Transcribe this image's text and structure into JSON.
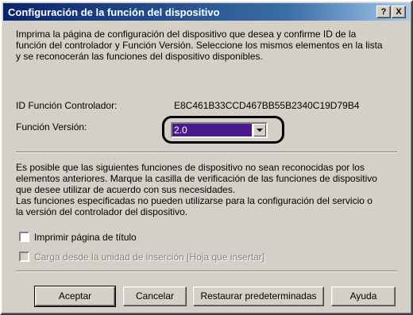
{
  "window": {
    "title": "Configuración de la función del dispositivo",
    "help_glyph": "?",
    "close_glyph": "X"
  },
  "intro": {
    "lines": [
      "Imprima la página de configuración del dispositivo que desea y confirme ID de la",
      "función del controlador y Función Versión. Seleccione los mismos elementos en la lista",
      "y se reconocerán las funciones del dispositivo disponibles."
    ]
  },
  "fields": {
    "id_label": "ID Función Controlador:",
    "id_value": "E8C461B33CCD467BB55B2340C19D79B4",
    "version_label": "Función Versión:",
    "version_selected": "2.0"
  },
  "description": {
    "lines": [
      "Es posible que las siguientes funciones de dispositivo no sean reconocidas por los",
      "elementos anteriores. Marque la casilla de verificación de las funciones de dispositivo",
      "que desee utilizar de acuerdo con sus necesidades.",
      "Las funciones especificadas no pueden utilizarse para la configuración del servicio o",
      "la versión del controlador del dispositivo."
    ]
  },
  "options": [
    {
      "label": "Imprimir página de título",
      "checked": false,
      "enabled": true
    },
    {
      "label": "Carga desde la unidad de inserción [Hoja que insertar]",
      "checked": false,
      "enabled": false
    }
  ],
  "buttons": {
    "ok": "Aceptar",
    "cancel": "Cancelar",
    "restore": "Restaurar predeterminadas",
    "help": "Ayuda"
  }
}
